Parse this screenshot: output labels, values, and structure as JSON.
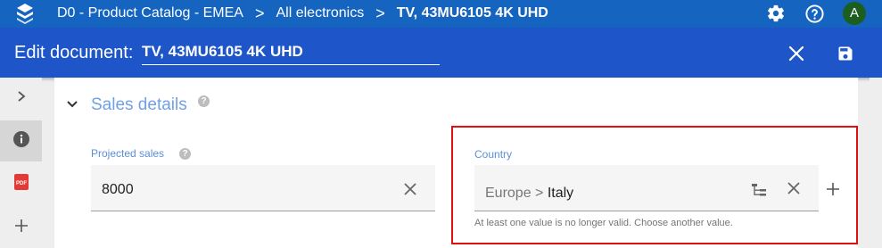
{
  "app": {
    "breadcrumbs": [
      "D0 - Product Catalog - EMEA",
      "All electronics",
      "TV, 43MU6105 4K UHD"
    ],
    "breadcrumb_separator": ">",
    "avatar_initial": "A",
    "icons": [
      "layers-logo-icon",
      "gear-icon",
      "help-icon"
    ]
  },
  "editbar": {
    "label": "Edit document:",
    "document_name": "TV, 43MU6105 4K UHD",
    "icons": [
      "close-icon",
      "save-icon"
    ]
  },
  "rail": {
    "icons": [
      "chevron-right-icon",
      "info-icon",
      "pdf-icon",
      "plus-icon"
    ],
    "active": "info-icon"
  },
  "section": {
    "title": "Sales details",
    "help": "?"
  },
  "fields": {
    "projected_sales": {
      "label": "Projected sales",
      "help": "?",
      "value": "8000"
    },
    "country": {
      "label": "Country",
      "path_parent": "Europe",
      "path_sep": " > ",
      "path_leaf": "Italy",
      "hint": "At least one value is no longer valid. Choose another value."
    }
  },
  "colors": {
    "topbar": "#1565c0",
    "editbar": "#1e56c9",
    "accent_label": "#5b8fd9",
    "section_title": "#6fa0e8",
    "error_highlight": "#e01010",
    "avatar": "#1b5e20"
  }
}
